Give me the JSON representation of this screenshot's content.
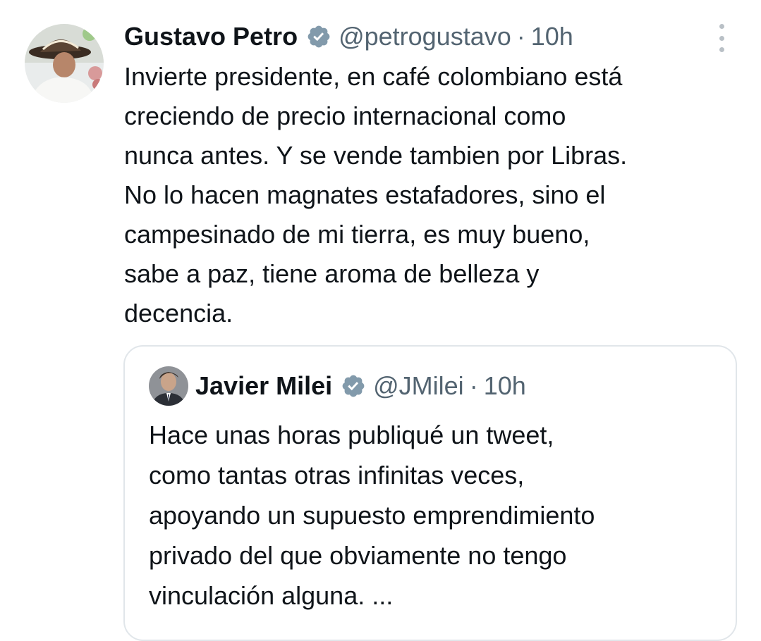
{
  "colors": {
    "text": "#0f1419",
    "secondary": "#536471",
    "verified_badge": "#829aab",
    "border": "#e1e6ea"
  },
  "main_tweet": {
    "author_name": "Gustavo Petro",
    "handle": "@petrogustavo",
    "separator": "·",
    "time": "10h",
    "lines": [
      "Invierte presidente, en café colombiano está",
      "creciendo de precio internacional como",
      "nunca antes. Y se vende tambien por Libras.",
      "No lo hacen magnates estafadores, sino el",
      "campesinado de mi tierra, es muy bueno,",
      "sabe a paz, tiene aroma de belleza y",
      "decencia."
    ]
  },
  "quoted_tweet": {
    "author_name": "Javier Milei",
    "handle": "@JMilei",
    "separator": "·",
    "time": "10h",
    "lines": [
      "Hace unas horas publiqué un tweet,",
      "como tantas otras infinitas veces,",
      "apoyando un supuesto emprendimiento",
      "privado del que obviamente no tengo",
      "vinculación alguna. ..."
    ]
  },
  "icons": {
    "verified": "verified-badge-icon",
    "more": "more-vertical-icon"
  }
}
